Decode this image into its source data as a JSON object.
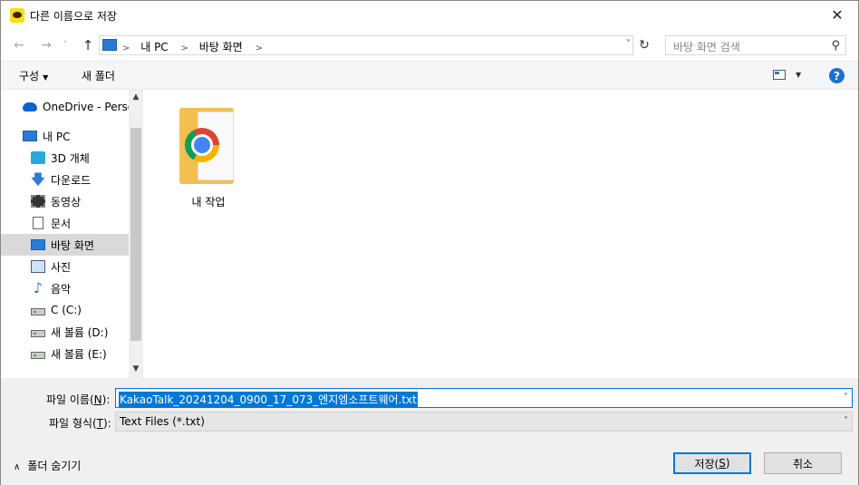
{
  "window": {
    "title": "다른 이름으로 저장",
    "close": "✕"
  },
  "nav": {
    "back": "←",
    "forward": "→",
    "recent": "˅",
    "up": "↑",
    "breadcrumbs": [
      "내 PC",
      "바탕 화면"
    ],
    "sep": ">",
    "dropdown": "˅",
    "refresh": "↻",
    "search_placeholder": "바탕 화면 검색",
    "search_icon": "⚲"
  },
  "toolbar": {
    "organize": "구성",
    "organize_caret": "▼",
    "new_folder": "새 폴더",
    "view_caret": "▼",
    "help": "?"
  },
  "sidebar": {
    "items": [
      {
        "label": "OneDrive - Person",
        "icon": "cloud-icon"
      },
      {
        "label": "내 PC",
        "icon": "pc-icon"
      },
      {
        "label": "3D 개체",
        "icon": "3d-objects-icon"
      },
      {
        "label": "다운로드",
        "icon": "download-icon",
        "glyph": "🡇"
      },
      {
        "label": "동영상",
        "icon": "video-icon"
      },
      {
        "label": "문서",
        "icon": "document-icon"
      },
      {
        "label": "바탕 화면",
        "icon": "desktop-icon",
        "selected": true
      },
      {
        "label": "사진",
        "icon": "picture-icon"
      },
      {
        "label": "음악",
        "icon": "music-icon",
        "glyph": "♪"
      },
      {
        "label": "C (C:)",
        "icon": "drive-icon"
      },
      {
        "label": "새 볼륨 (D:)",
        "icon": "drive-icon"
      },
      {
        "label": "새 볼륨 (E:)",
        "icon": "drive-icon"
      }
    ],
    "scroll_up": "▲",
    "scroll_down": "▼"
  },
  "content": {
    "items": [
      {
        "label": "내 작업",
        "icon": "folder-chrome-icon"
      }
    ]
  },
  "form": {
    "filename_label": "파일 이름(",
    "filename_key": "N",
    "filename_label_end": "):",
    "filename_value": "KakaoTalk_20241204_0900_17_073_엔지엠소프트웨어.txt",
    "filetype_label": "파일 형식(",
    "filetype_key": "T",
    "filetype_label_end": "):",
    "filetype_value": "Text Files (*.txt)",
    "caret": "˅"
  },
  "footer": {
    "hide_folders": "폴더 숨기기",
    "hide_chevron": "∧",
    "save_label": "저장(",
    "save_key": "S",
    "save_end": ")",
    "cancel_label": "취소"
  }
}
